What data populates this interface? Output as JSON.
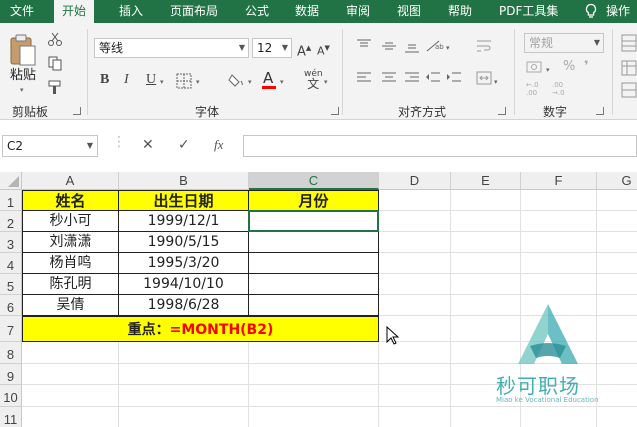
{
  "ribbon_tabs": [
    "文件",
    "开始",
    "插入",
    "页面布局",
    "公式",
    "数据",
    "审阅",
    "视图",
    "帮助",
    "PDF工具集",
    "操作"
  ],
  "clipboard": {
    "paste_label": "粘贴",
    "group_label": "剪贴板"
  },
  "font": {
    "name": "等线",
    "size": "12",
    "group_label": "字体",
    "bold": "B",
    "italic": "I",
    "underline": "U",
    "font_color_label": "A",
    "phonetic_label": "wén"
  },
  "alignment": {
    "group_label": "对齐方式"
  },
  "number": {
    "format": "常规",
    "group_label": "数字",
    "percent": "%"
  },
  "formula_bar": {
    "name_box": "C2",
    "cancel": "✕",
    "enter": "✓",
    "fx": "fx",
    "content": ""
  },
  "columns": [
    "A",
    "B",
    "C",
    "D",
    "E",
    "F",
    "G"
  ],
  "rows": [
    "1",
    "2",
    "3",
    "4",
    "5",
    "6",
    "7",
    "8",
    "9",
    "10",
    "11"
  ],
  "table": {
    "headers": [
      "姓名",
      "出生日期",
      "月份"
    ],
    "rows": [
      [
        "秒小可",
        "1999/12/1",
        ""
      ],
      [
        "刘潇潇",
        "1990/5/15",
        ""
      ],
      [
        "杨肖鸣",
        "1995/3/20",
        ""
      ],
      [
        "陈孔明",
        "1994/10/10",
        ""
      ],
      [
        "吴倩",
        "1998/6/28",
        ""
      ]
    ]
  },
  "note": {
    "label": "重点：",
    "formula": "=MONTH(B2)"
  },
  "watermark": {
    "brand": "秒可职场",
    "tagline": "Miao ke Vocational Education"
  },
  "colors": {
    "excel_green": "#217346",
    "header_fill": "#ffff00",
    "formula_red": "#ff0000",
    "font_color_bar": "#ff0000"
  }
}
